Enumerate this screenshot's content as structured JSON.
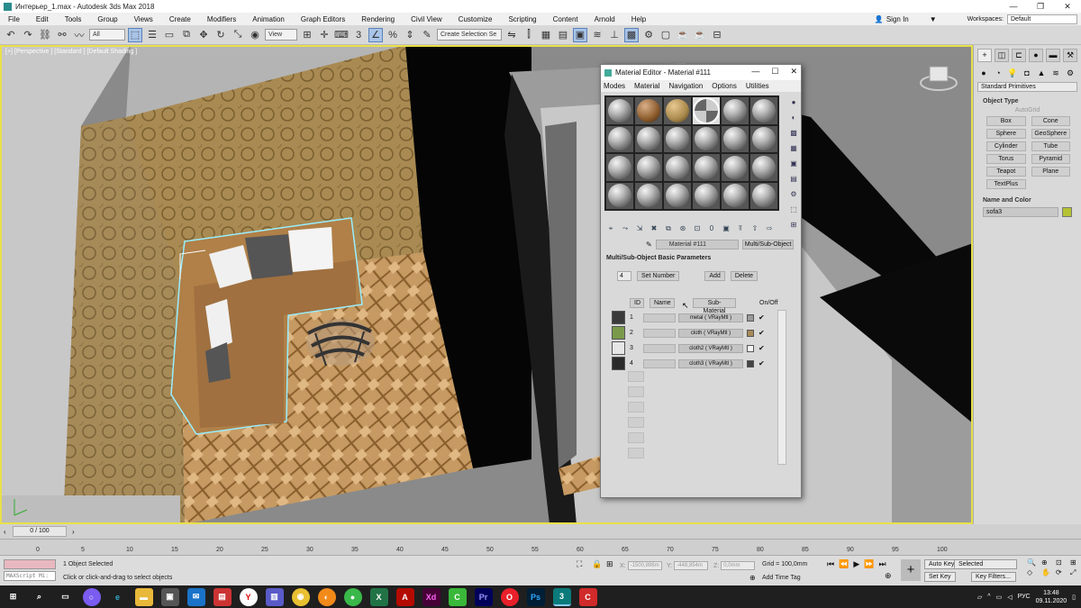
{
  "window": {
    "title": "Интерьер_1.max - Autodesk 3ds Max 2018"
  },
  "menu": [
    "File",
    "Edit",
    "Tools",
    "Group",
    "Views",
    "Create",
    "Modifiers",
    "Animation",
    "Graph Editors",
    "Rendering",
    "Civil View",
    "Customize",
    "Scripting",
    "Content",
    "Arnold",
    "Help"
  ],
  "account": {
    "sign_in": "Sign In",
    "workspaces_label": "Workspaces:",
    "workspace": "Default"
  },
  "toolbar": {
    "filter": "All",
    "view": "View",
    "selection_set": "Create Selection Se"
  },
  "viewport": {
    "label": "[+] [Perspective ] [Standard ] [Default Shading ]"
  },
  "command_panel": {
    "category": "Standard Primitives",
    "object_type_title": "Object Type",
    "autogrid": "AutoGrid",
    "buttons": [
      "Box",
      "Cone",
      "Sphere",
      "GeoSphere",
      "Cylinder",
      "Tube",
      "Torus",
      "Pyramid",
      "Teapot",
      "Plane",
      "TextPlus"
    ],
    "name_color_title": "Name and Color",
    "object_name": "sofa3",
    "object_color": "#b5c234"
  },
  "material_editor": {
    "title": "Material Editor - Material #111",
    "menu": [
      "Modes",
      "Material",
      "Navigation",
      "Options",
      "Utilities"
    ],
    "material_name": "Material #111",
    "material_type": "Multi/Sub-Object",
    "rollout_title": "Multi/Sub-Object Basic Parameters",
    "count": "4",
    "set_number": "Set Number",
    "add": "Add",
    "delete": "Delete",
    "col_id": "ID",
    "col_name": "Name",
    "col_sub": "Sub-Material",
    "col_onoff": "On/Off",
    "rows": [
      {
        "id": "1",
        "sub": "metal  ( VRayMtl )",
        "color": "#9a9a9a",
        "thumb": "#3a3a3a",
        "on": "✔"
      },
      {
        "id": "2",
        "sub": "cloth  ( VRayMtl )",
        "color": "#a88a58",
        "thumb": "#7a9a4a",
        "on": "✔"
      },
      {
        "id": "3",
        "sub": "cloth2  ( VRayMtl )",
        "color": "#f4f4f4",
        "thumb": "#e6e6e6",
        "on": "✔"
      },
      {
        "id": "4",
        "sub": "cloth3  ( VRayMtl )",
        "color": "#444444",
        "thumb": "#2a2a2a",
        "on": "✔"
      }
    ]
  },
  "timeline": {
    "slider": "0 / 100",
    "ticks": [
      "0",
      "5",
      "10",
      "15",
      "20",
      "25",
      "30",
      "35",
      "40",
      "45",
      "50",
      "55",
      "60",
      "65",
      "70",
      "75",
      "80",
      "85",
      "90",
      "95",
      "100"
    ]
  },
  "status": {
    "maxscript": "MAXScript Mi:",
    "selected": "1 Object Selected",
    "prompt": "Click or click-and-drag to select objects",
    "x_label": "X:",
    "x_val": "-1500,898m",
    "y_label": "Y:",
    "y_val": "-448,854m",
    "z_label": "Z:",
    "z_val": "0,0mm",
    "grid": "Grid = 100,0mm",
    "add_time_tag": "Add Time Tag",
    "auto_key": "Auto Key",
    "set_key": "Set Key",
    "selected_dd": "Selected",
    "key_filters": "Key Filters..."
  },
  "taskbar": {
    "lang": "РУС",
    "time": "13:48",
    "date": "09.11.2020"
  }
}
